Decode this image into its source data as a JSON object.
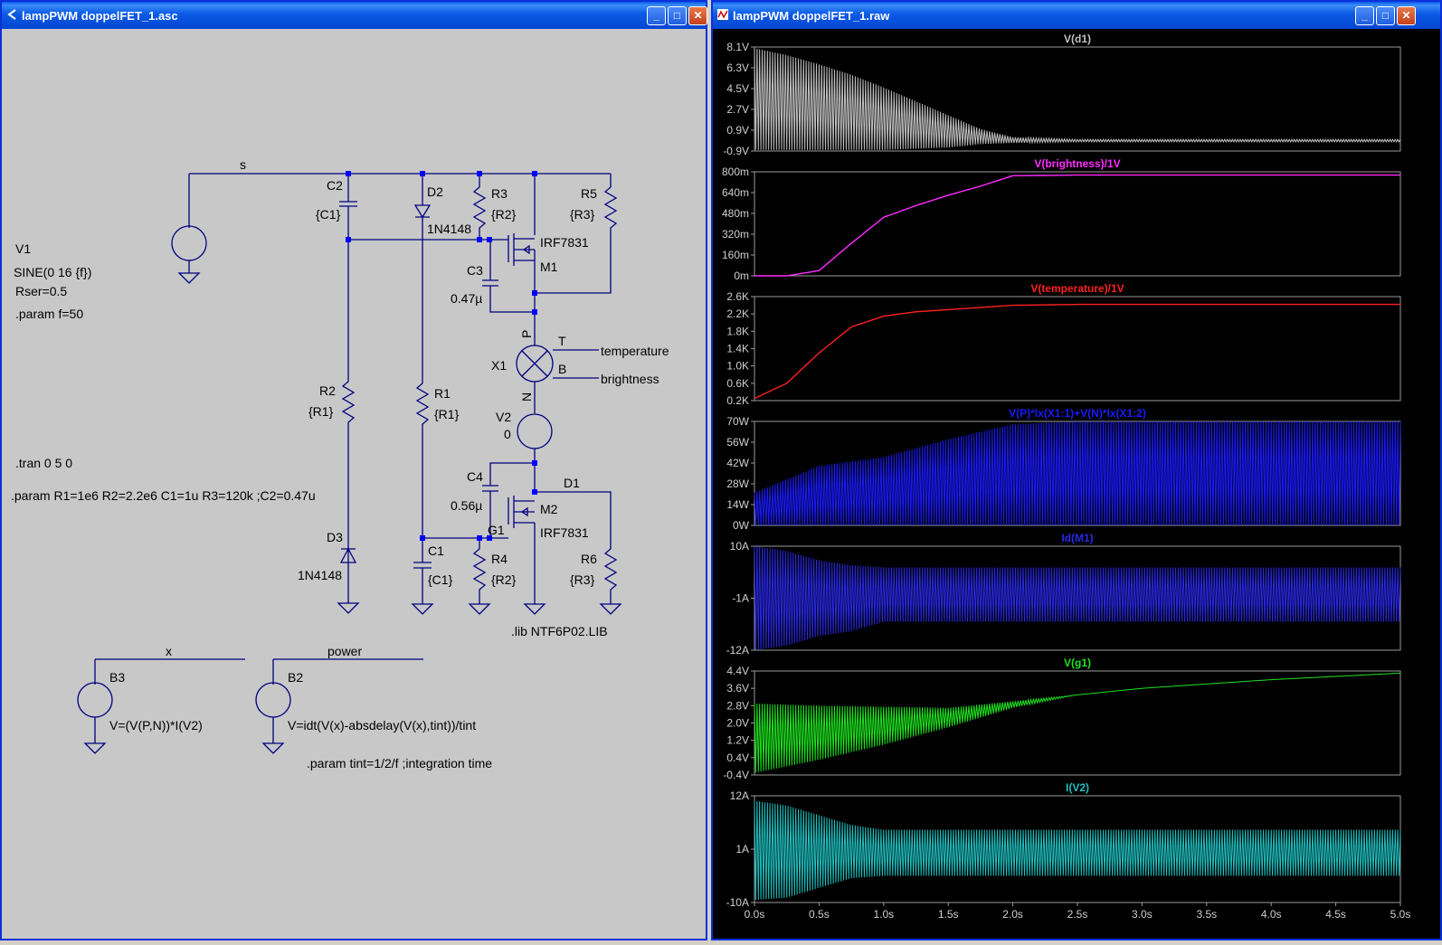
{
  "schematic_window": {
    "title": "lampPWM doppelFET_1.asc",
    "buttons": {
      "minimize": "_",
      "maximize": "□",
      "close": "✕"
    },
    "nets": {
      "s": "s",
      "temperature": "temperature",
      "brightness": "brightness",
      "x": "x",
      "power": "power"
    },
    "components": {
      "C2": {
        "name": "C2",
        "value": "{C1}"
      },
      "D2": {
        "name": "D2",
        "value": "1N4148"
      },
      "R3": {
        "name": "R3",
        "value": "{R2}"
      },
      "R5": {
        "name": "R5",
        "value": "{R3}"
      },
      "M1": {
        "name": "M1",
        "value": "IRF7831"
      },
      "C3": {
        "name": "C3",
        "value": "0.47µ"
      },
      "X1": {
        "name": "X1",
        "pin_p": "P",
        "pin_n": "N",
        "pin_t": "T",
        "pin_b": "B"
      },
      "V2": {
        "name": "V2",
        "value": "0"
      },
      "R2": {
        "name": "R2",
        "value": "{R1}"
      },
      "R1": {
        "name": "R1",
        "value": "{R1}"
      },
      "C4": {
        "name": "C4",
        "value": "0.56µ"
      },
      "D1": {
        "name": "D1"
      },
      "M2": {
        "name": "M2",
        "value": "IRF7831"
      },
      "G1": {
        "name": "G1"
      },
      "R4": {
        "name": "R4",
        "value": "{R2}"
      },
      "R6": {
        "name": "R6",
        "value": "{R3}"
      },
      "C1": {
        "name": "C1",
        "value": "{C1}"
      },
      "D3": {
        "name": "D3",
        "value": "1N4148"
      },
      "V1": {
        "name": "V1",
        "value": "SINE(0 16 {f})",
        "rser": "Rser=0.5"
      },
      "B3": {
        "name": "B3",
        "value": "V=(V(P,N))*I(V2)"
      },
      "B2": {
        "name": "B2",
        "value": "V=idt(V(x)-absdelay(V(x),tint))/tint"
      }
    },
    "directives": {
      "param_f": ".param f=50",
      "tran": ".tran 0 5 0",
      "params": ".param R1=1e6 R2=2.2e6 C1=1u R3=120k ;C2=0.47u",
      "lib": ".lib NTF6P02.LIB",
      "tint": ".param tint=1/2/f ;integration time"
    }
  },
  "plot_window": {
    "title": "lampPWM doppelFET_1.raw",
    "buttons": {
      "minimize": "_",
      "maximize": "□",
      "close": "✕"
    }
  },
  "chart_data": [
    {
      "type": "line",
      "title": "V(d1)",
      "color": "#c0c0c0",
      "y_ticks": [
        "8.1V",
        "6.3V",
        "4.5V",
        "2.7V",
        "0.9V",
        "-0.9V"
      ],
      "ylim": [
        -0.9,
        8.1
      ],
      "x": [
        0.0,
        0.25,
        0.5,
        0.75,
        1.0,
        1.25,
        1.5,
        1.75,
        2.0,
        2.5,
        3.0,
        5.0
      ],
      "envelope_max": [
        8.0,
        7.4,
        6.6,
        5.7,
        4.6,
        3.4,
        2.2,
        1.0,
        0.3,
        0.1,
        0.1,
        0.1
      ],
      "envelope_min": [
        -0.8,
        -0.8,
        -0.8,
        -0.8,
        -0.8,
        -0.7,
        -0.6,
        -0.3,
        -0.2,
        -0.1,
        -0.1,
        -0.1
      ]
    },
    {
      "type": "line",
      "title": "V(brightness)/1V",
      "color": "#ff2cff",
      "y_ticks": [
        "800m",
        "640m",
        "480m",
        "320m",
        "160m",
        "0m"
      ],
      "ylim": [
        0,
        800
      ],
      "x": [
        0.0,
        0.25,
        0.5,
        0.75,
        1.0,
        1.25,
        1.5,
        1.75,
        2.0,
        2.5,
        3.0,
        4.0,
        5.0
      ],
      "values": [
        0,
        0,
        40,
        250,
        450,
        540,
        620,
        690,
        770,
        775,
        775,
        775,
        775
      ]
    },
    {
      "type": "line",
      "title": "V(temperature)/1V",
      "color": "#ff2020",
      "y_ticks": [
        "2.6K",
        "2.2K",
        "1.8K",
        "1.4K",
        "1.0K",
        "0.6K",
        "0.2K"
      ],
      "ylim": [
        0.2,
        2.6
      ],
      "x": [
        0.0,
        0.25,
        0.5,
        0.75,
        1.0,
        1.25,
        1.5,
        2.0,
        2.5,
        3.0,
        5.0
      ],
      "values": [
        0.25,
        0.6,
        1.3,
        1.9,
        2.15,
        2.25,
        2.3,
        2.4,
        2.42,
        2.42,
        2.42
      ]
    },
    {
      "type": "line",
      "title": "V(P)*Ix(X1:1)+V(N)*Ix(X1:2)",
      "color": "#1a1aff",
      "y_ticks": [
        "70W",
        "56W",
        "42W",
        "28W",
        "14W",
        "0W"
      ],
      "ylim": [
        0,
        70
      ],
      "x": [
        0.0,
        0.5,
        1.0,
        1.5,
        2.0,
        2.5,
        3.0,
        5.0
      ],
      "envelope_max": [
        22,
        40,
        46,
        58,
        68,
        70,
        70,
        70
      ],
      "envelope_min": [
        0,
        0,
        0,
        0,
        0,
        0,
        0,
        0
      ]
    },
    {
      "type": "line",
      "title": "Id(M1)",
      "color": "#2828e6",
      "y_ticks": [
        "10A",
        "-1A",
        "-12A"
      ],
      "ylim": [
        -12,
        10
      ],
      "x": [
        0.0,
        0.25,
        0.5,
        0.75,
        1.0,
        1.5,
        2.0,
        5.0
      ],
      "envelope_max": [
        10,
        9,
        7,
        6,
        5.5,
        5.5,
        5.5,
        5.5
      ],
      "envelope_min": [
        -12,
        -11,
        -9,
        -8,
        -6,
        -6,
        -6,
        -6
      ]
    },
    {
      "type": "line",
      "title": "V(g1)",
      "color": "#1ee31e",
      "y_ticks": [
        "4.4V",
        "3.6V",
        "2.8V",
        "2.0V",
        "1.2V",
        "0.4V",
        "-0.4V"
      ],
      "ylim": [
        -0.4,
        4.4
      ],
      "x": [
        0.0,
        0.5,
        1.0,
        1.5,
        2.0,
        2.5,
        3.0,
        3.5,
        4.0,
        4.5,
        5.0
      ],
      "envelope_max": [
        2.9,
        2.8,
        2.75,
        2.7,
        3.0,
        3.3,
        3.6,
        3.8,
        4.0,
        4.15,
        4.3
      ],
      "envelope_min": [
        -0.3,
        0.3,
        1.0,
        1.8,
        2.7,
        3.3,
        3.6,
        3.8,
        4.0,
        4.15,
        4.3
      ]
    },
    {
      "type": "line",
      "title": "I(V2)",
      "color": "#20c0c0",
      "y_ticks": [
        "12A",
        "1A",
        "-10A"
      ],
      "ylim": [
        -10,
        12
      ],
      "x": [
        0.0,
        0.25,
        0.5,
        0.75,
        1.0,
        1.5,
        2.0,
        5.0
      ],
      "envelope_max": [
        11,
        10,
        8,
        6,
        5,
        5,
        5,
        5
      ],
      "envelope_min": [
        -9.5,
        -9,
        -7,
        -5,
        -4.5,
        -4.5,
        -4.5,
        -4.5
      ]
    }
  ],
  "x_axis": {
    "ticks": [
      "0.0s",
      "0.5s",
      "1.0s",
      "1.5s",
      "2.0s",
      "2.5s",
      "3.0s",
      "3.5s",
      "4.0s",
      "4.5s",
      "5.0s"
    ],
    "xlim": [
      0,
      5
    ]
  }
}
